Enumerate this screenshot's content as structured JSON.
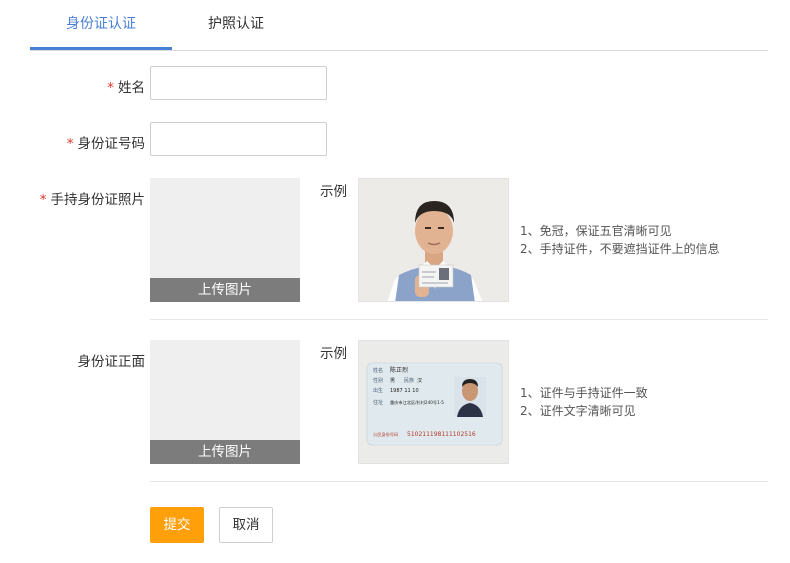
{
  "tabs": [
    {
      "label": "身份证认证",
      "active": true
    },
    {
      "label": "护照认证",
      "active": false
    }
  ],
  "form": {
    "required_mark": "*",
    "name_label": "姓名",
    "name_value": "",
    "id_number_label": "身份证号码",
    "id_number_value": "",
    "handheld_label": "手持身份证照片",
    "front_label": "身份证正面",
    "upload_label": "上传图片",
    "example_label": "示例"
  },
  "handheld_tips": [
    "1、免冠，保证五官清晰可见",
    "2、手持证件，不要遮挡证件上的信息"
  ],
  "front_tips": [
    "1、证件与手持证件一致",
    "2、证件文字清晰可见"
  ],
  "id_card_sample": {
    "name_field": "姓名",
    "name_value": "陈正烈",
    "gender_field": "性别",
    "gender_value": "男",
    "ethnicity_field": "民族",
    "ethnicity_value": "汉",
    "birth_field": "出生",
    "birth_value": "1987 11 10",
    "address_field": "住址",
    "address_value": "重庆市江北区/杉村240号1-5",
    "number_field": "公民身份号码",
    "number_value": "510211198111102516"
  },
  "buttons": {
    "submit": "提交",
    "cancel": "取消"
  },
  "colors": {
    "accent": "#4a7fd6",
    "submit": "#ff9f0a",
    "required": "#e0342a",
    "upload_button": "#7c7c7c"
  }
}
